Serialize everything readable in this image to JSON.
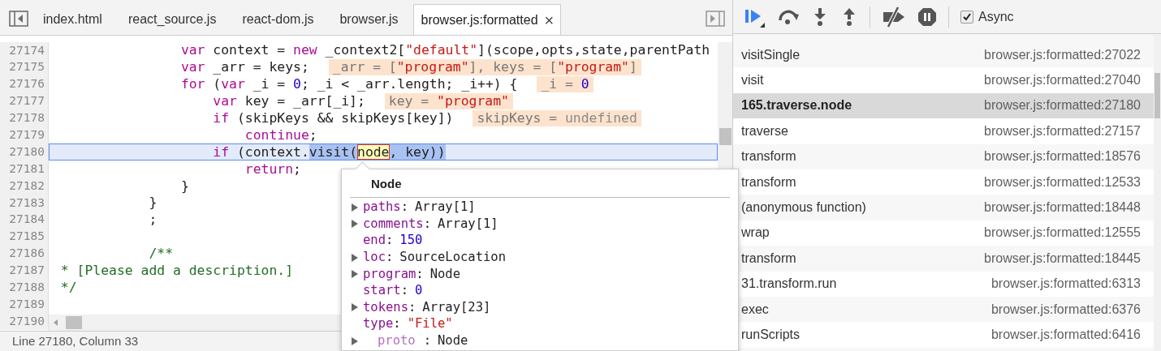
{
  "tabs": [
    {
      "label": "index.html",
      "selected": false
    },
    {
      "label": "react_source.js",
      "selected": false
    },
    {
      "label": "react-dom.js",
      "selected": false
    },
    {
      "label": "browser.js",
      "selected": false
    },
    {
      "label": "browser.js:formatted",
      "selected": true,
      "close_glyph": "×"
    }
  ],
  "code": {
    "lines": [
      {
        "number": "27174",
        "current": false,
        "tokens": [
          {
            "kind": "keyword",
            "text": "                var"
          },
          {
            "kind": "plain",
            "text": " context = "
          },
          {
            "kind": "keyword",
            "text": "new"
          },
          {
            "kind": "plain",
            "text": " _context2["
          },
          {
            "kind": "string",
            "text": "\"default\""
          },
          {
            "kind": "plain",
            "text": "](scope,opts,state,parentPath"
          }
        ]
      },
      {
        "number": "27175",
        "current": false,
        "tokens": [
          {
            "kind": "keyword",
            "text": "                var"
          },
          {
            "kind": "plain",
            "text": " _arr = keys;"
          }
        ],
        "inline_values": [
          {
            "kind": "plain",
            "text": "_arr = ["
          },
          {
            "kind": "string",
            "text": "\"program\""
          },
          {
            "kind": "plain",
            "text": "], keys = ["
          },
          {
            "kind": "string",
            "text": "\"program\""
          },
          {
            "kind": "plain",
            "text": "]"
          }
        ]
      },
      {
        "number": "27176",
        "current": false,
        "tokens": [
          {
            "kind": "keyword",
            "text": "                for"
          },
          {
            "kind": "plain",
            "text": " ("
          },
          {
            "kind": "keyword",
            "text": "var"
          },
          {
            "kind": "plain",
            "text": " _i = "
          },
          {
            "kind": "number",
            "text": "0"
          },
          {
            "kind": "plain",
            "text": "; _i < _arr.length; _i++) {"
          }
        ],
        "inline_values": [
          {
            "kind": "plain",
            "text": "_i = "
          },
          {
            "kind": "number",
            "text": "0"
          }
        ]
      },
      {
        "number": "27177",
        "current": false,
        "tokens": [
          {
            "kind": "keyword",
            "text": "                    var"
          },
          {
            "kind": "plain",
            "text": " key = _arr[_i];"
          }
        ],
        "inline_values": [
          {
            "kind": "plain",
            "text": "key = "
          },
          {
            "kind": "string",
            "text": "\"program\""
          }
        ]
      },
      {
        "number": "27178",
        "current": false,
        "tokens": [
          {
            "kind": "keyword",
            "text": "                    if"
          },
          {
            "kind": "plain",
            "text": " (skipKeys && skipKeys[key])"
          }
        ],
        "inline_values": [
          {
            "kind": "plain",
            "text": "skipKeys = "
          },
          {
            "kind": "undefined",
            "text": "undefined"
          }
        ]
      },
      {
        "number": "27179",
        "current": false,
        "tokens": [
          {
            "kind": "keyword",
            "text": "                        continue"
          },
          {
            "kind": "plain",
            "text": ";"
          }
        ]
      },
      {
        "number": "27180",
        "current": true,
        "tokens": [
          {
            "kind": "keyword",
            "text": "                    if"
          },
          {
            "kind": "plain",
            "text": " (context."
          },
          {
            "kind": "selection",
            "text": "visit("
          },
          {
            "kind": "hovered",
            "text": "node"
          },
          {
            "kind": "selection",
            "text": ", key))"
          }
        ]
      },
      {
        "number": "27181",
        "current": false,
        "tokens": [
          {
            "kind": "keyword",
            "text": "                        return"
          },
          {
            "kind": "plain",
            "text": ";"
          }
        ]
      },
      {
        "number": "27182",
        "current": false,
        "tokens": [
          {
            "kind": "plain",
            "text": "                }"
          }
        ]
      },
      {
        "number": "27183",
        "current": false,
        "tokens": [
          {
            "kind": "plain",
            "text": "            }"
          }
        ]
      },
      {
        "number": "27184",
        "current": false,
        "tokens": [
          {
            "kind": "plain",
            "text": "            ;"
          }
        ]
      },
      {
        "number": "27185",
        "current": false
      },
      {
        "number": "27186",
        "current": false,
        "tokens": [
          {
            "kind": "comment",
            "text": "            /**"
          }
        ]
      },
      {
        "number": "27187",
        "current": false,
        "tokens": [
          {
            "kind": "comment",
            "text": " * [Please add a description.]"
          }
        ]
      },
      {
        "number": "27188",
        "current": false,
        "tokens": [
          {
            "kind": "comment",
            "text": " */"
          }
        ]
      },
      {
        "number": "27189",
        "current": false
      },
      {
        "number": "27190",
        "current": false
      }
    ],
    "status": "Line 27180, Column 33"
  },
  "popover": {
    "title": "Node",
    "properties": [
      {
        "name": "paths",
        "separator": ":",
        "value": "Array[1]",
        "kind": "object",
        "expandable": true,
        "dim": false
      },
      {
        "name": "comments",
        "separator": ":",
        "value": "Array[1]",
        "kind": "object",
        "expandable": true,
        "dim": false
      },
      {
        "name": "end",
        "separator": ":",
        "value": "150",
        "kind": "number",
        "expandable": false,
        "dim": false
      },
      {
        "name": "loc",
        "separator": ":",
        "value": "SourceLocation",
        "kind": "object",
        "expandable": true,
        "dim": false
      },
      {
        "name": "program",
        "separator": ":",
        "value": "Node",
        "kind": "object",
        "expandable": true,
        "dim": false
      },
      {
        "name": "start",
        "separator": ":",
        "value": "0",
        "kind": "number",
        "expandable": false,
        "dim": false
      },
      {
        "name": "tokens",
        "separator": ":",
        "value": "Array[23]",
        "kind": "object",
        "expandable": true,
        "dim": false
      },
      {
        "name": "type",
        "separator": ":",
        "value": "\"File\"",
        "kind": "string",
        "expandable": false,
        "dim": false
      },
      {
        "name": "proto",
        "separator": ":",
        "value": "Node",
        "kind": "object",
        "expandable": true,
        "dim": true
      }
    ]
  },
  "debugger_toolbar": {
    "async": {
      "label": "Async",
      "checked": true
    }
  },
  "call_stack": [
    {
      "name": "visitSingle",
      "location": "browser.js:formatted:27022",
      "selected": false
    },
    {
      "name": "visit",
      "location": "browser.js:formatted:27040",
      "selected": false
    },
    {
      "name": "165.traverse.node",
      "location": "browser.js:formatted:27180",
      "selected": true
    },
    {
      "name": "traverse",
      "location": "browser.js:formatted:27157",
      "selected": false
    },
    {
      "name": "transform",
      "location": "browser.js:formatted:18576",
      "selected": false
    },
    {
      "name": "transform",
      "location": "browser.js:formatted:12533",
      "selected": false
    },
    {
      "name": "(anonymous function)",
      "location": "browser.js:formatted:18448",
      "selected": false
    },
    {
      "name": "wrap",
      "location": "browser.js:formatted:12555",
      "selected": false
    },
    {
      "name": "transform",
      "location": "browser.js:formatted:18445",
      "selected": false
    },
    {
      "name": "31.transform.run",
      "location": "browser.js:formatted:6313",
      "selected": false
    },
    {
      "name": "exec",
      "location": "browser.js:formatted:6376",
      "selected": false
    },
    {
      "name": "runScripts",
      "location": "browser.js:formatted:6416",
      "selected": false
    }
  ]
}
